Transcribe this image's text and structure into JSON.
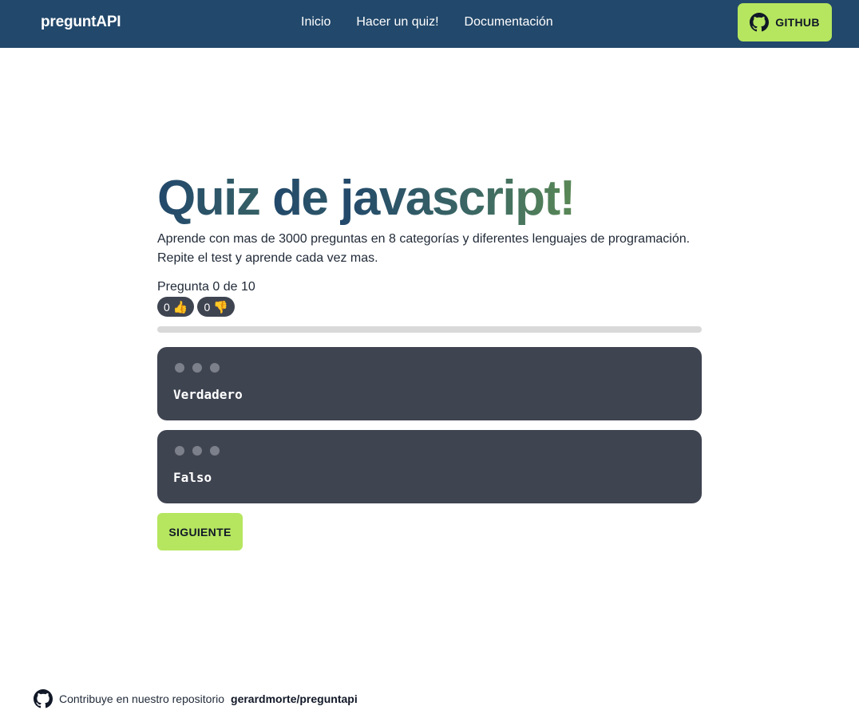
{
  "nav": {
    "brand": "preguntAPI",
    "links": [
      "Inicio",
      "Hacer un quiz!",
      "Documentación"
    ],
    "github_label": "GITHUB"
  },
  "quiz": {
    "title_words": [
      "Quiz",
      "de",
      "javascript!"
    ],
    "intro_line1": "Aprende con mas de 3000 preguntas en 8 categorías y diferentes lenguajes de programación.",
    "intro_line2": "Repite el test y aprende cada vez mas.",
    "counter": "Pregunta 0 de 10",
    "correct_count": "0",
    "correct_emoji": "👍",
    "wrong_count": "0",
    "wrong_emoji": "👎",
    "progress": 0,
    "answers": [
      "Verdadero",
      "Falso"
    ],
    "next_label": "SIGUIENTE"
  },
  "footer": {
    "text": "Contribuye en nuestro repositorio",
    "repo": "gerardmorte/preguntapi"
  },
  "colors": {
    "navbar": "#22486b",
    "accent": "#b6e65f",
    "card": "#3f4451"
  },
  "icons": {
    "github": "github-icon"
  }
}
